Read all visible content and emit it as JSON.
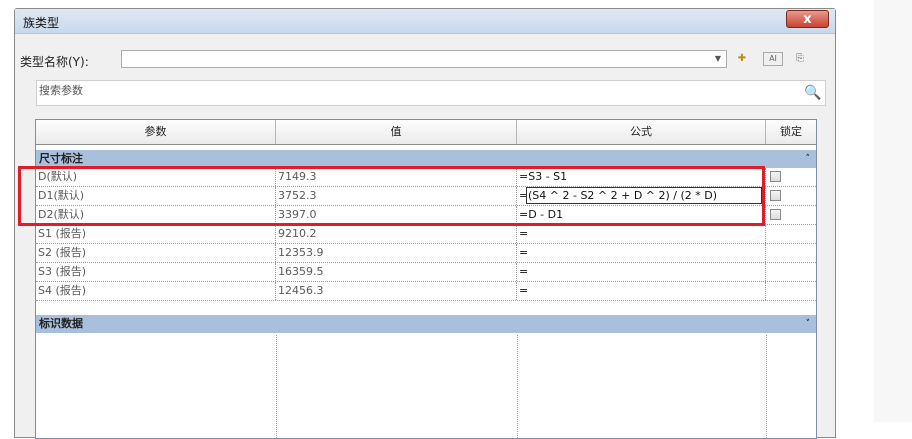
{
  "window": {
    "title": "族类型",
    "close_glyph": "x"
  },
  "type_row": {
    "label": "类型名称(Y):",
    "value": ""
  },
  "toolbar": {
    "icons": [
      "new-type-icon",
      "rename-type-icon",
      "delete-type-icon"
    ]
  },
  "search": {
    "placeholder": "搜索参数"
  },
  "table": {
    "headers": [
      "参数",
      "值",
      "公式",
      "锁定"
    ],
    "groups": [
      {
        "label": "尺寸标注",
        "chevron": "˄",
        "rows": [
          {
            "param": "D(默认)",
            "value": "7149.3",
            "formula": "S3 - S1",
            "lock": true
          },
          {
            "param": "D1(默认)",
            "value": "3752.3",
            "formula": "(S4 ^ 2 - S2 ^ 2 + D ^ 2) / (2 * D)",
            "lock": true
          },
          {
            "param": "D2(默认)",
            "value": "3397.0",
            "formula": "D - D1",
            "lock": true
          },
          {
            "param": "S1 (报告)",
            "value": "9210.2",
            "formula": "",
            "lock": false
          },
          {
            "param": "S2 (报告)",
            "value": "12353.9",
            "formula": "",
            "lock": false
          },
          {
            "param": "S3 (报告)",
            "value": "16359.5",
            "formula": "",
            "lock": false
          },
          {
            "param": "S4 (报告)",
            "value": "12456.3",
            "formula": "",
            "lock": false
          }
        ]
      },
      {
        "label": "标识数据",
        "chevron": "˅",
        "rows": []
      }
    ]
  },
  "colors": {
    "group_header": "#a9c0dc",
    "highlight": "#e01b2a",
    "close_button": "#c8432f"
  }
}
